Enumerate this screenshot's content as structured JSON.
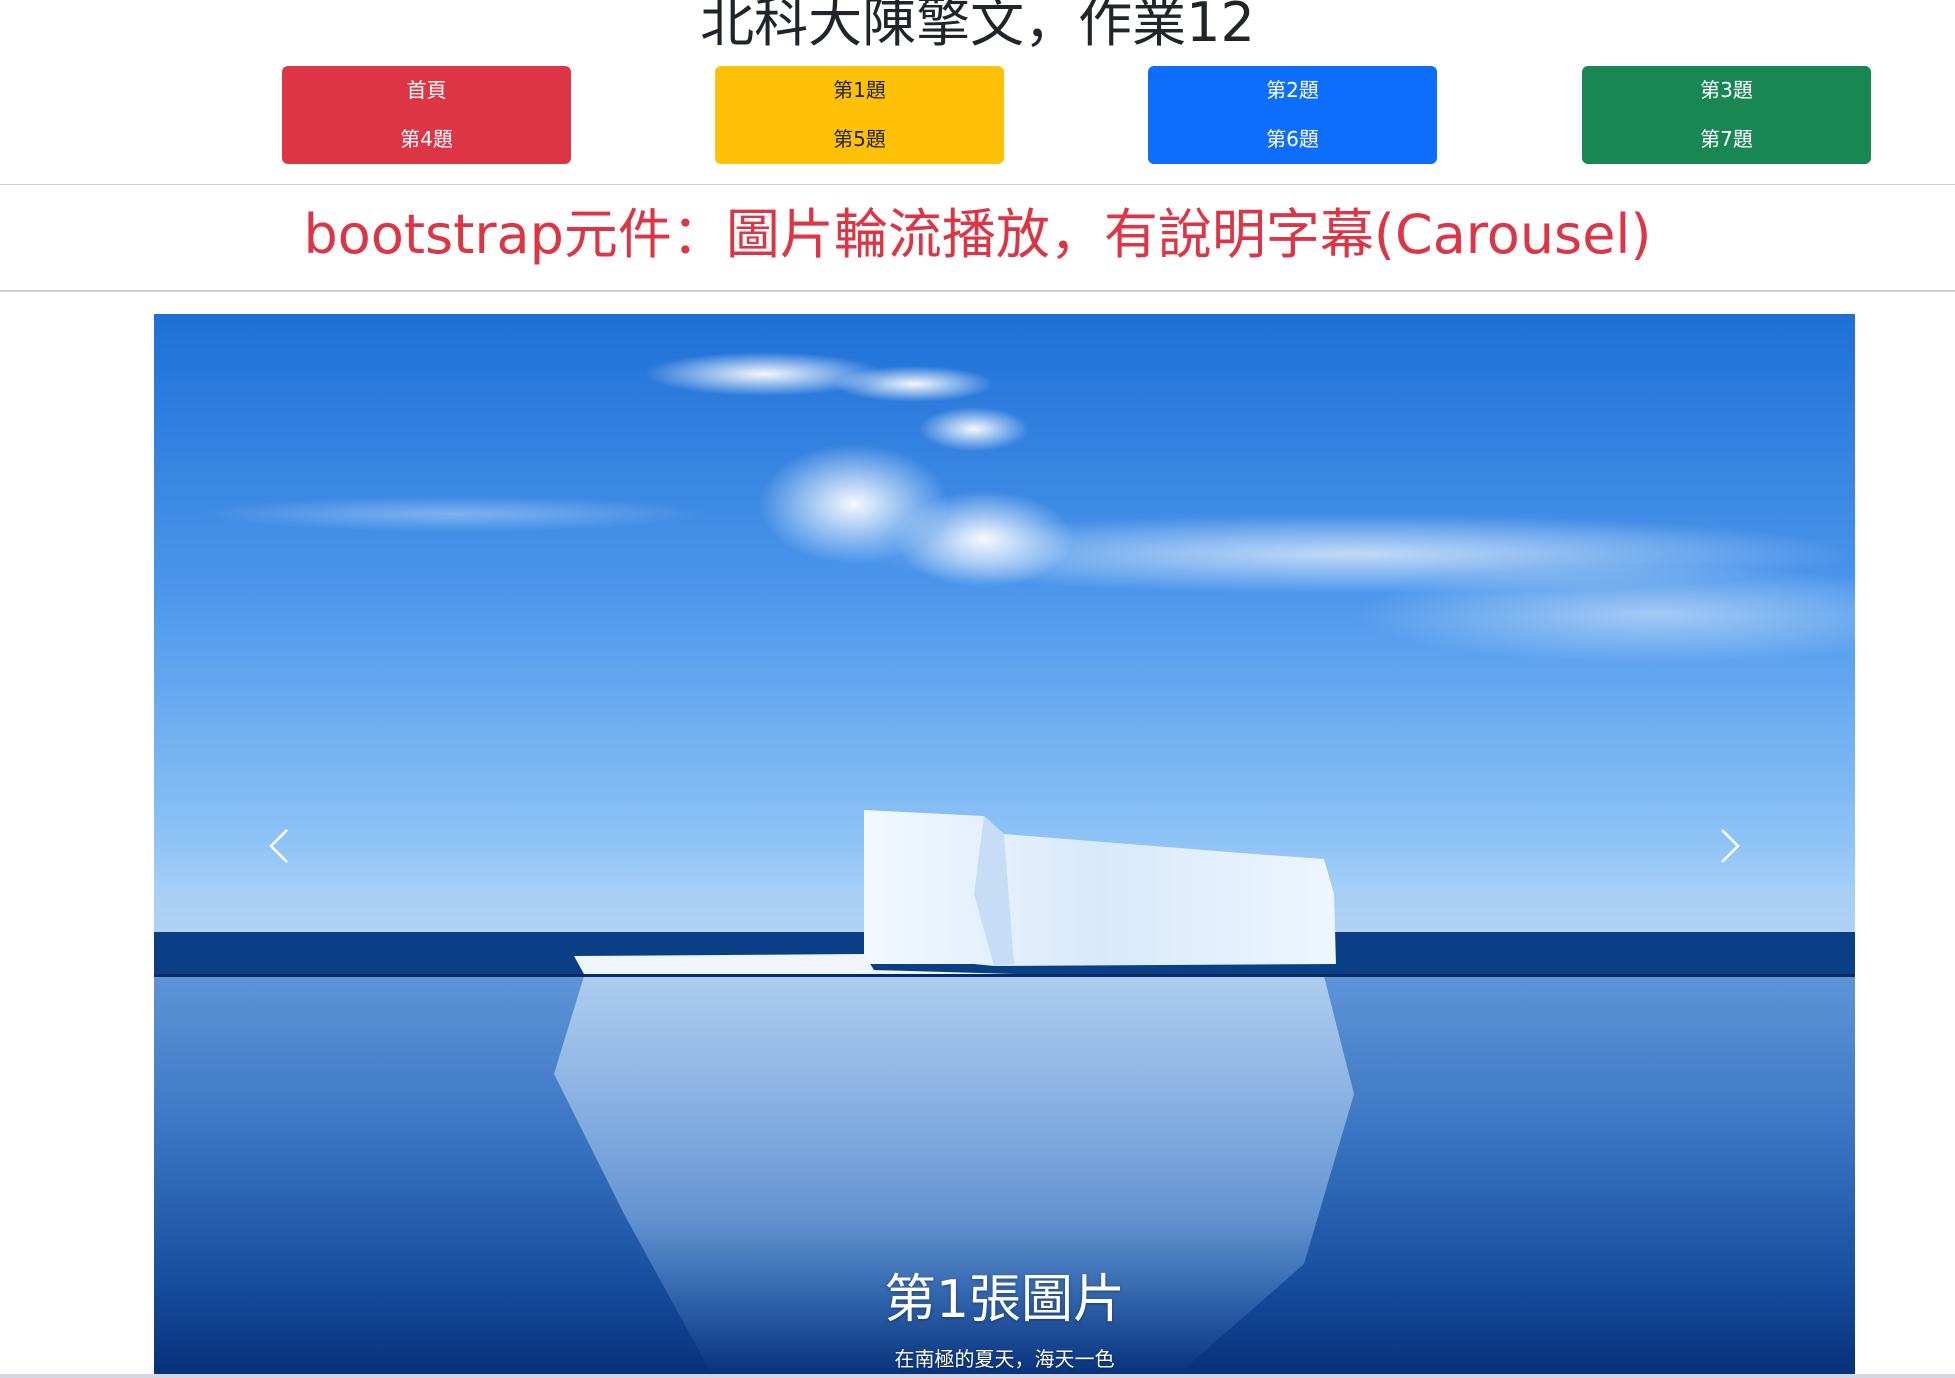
{
  "header": {
    "site_title": "北科大陳擎文，作業12"
  },
  "nav": {
    "row1": [
      {
        "label": "首頁",
        "color": "#dc3545"
      },
      {
        "label": "第1題",
        "color": "#ffc107"
      },
      {
        "label": "第2題",
        "color": "#0d6efd"
      },
      {
        "label": "第3題",
        "color": "#198754"
      }
    ],
    "row2": [
      {
        "label": "第4題",
        "color": "#dc3545"
      },
      {
        "label": "第5題",
        "color": "#ffc107"
      },
      {
        "label": "第6題",
        "color": "#0d6efd"
      },
      {
        "label": "第7題",
        "color": "#198754"
      }
    ]
  },
  "main": {
    "heading": "bootstrap元件：圖片輪流播放，有說明字幕(Carousel)",
    "heading_color": "#dc3545"
  },
  "carousel": {
    "image_icon": "iceberg-photo",
    "prev_icon": "chevron-left-icon",
    "next_icon": "chevron-right-icon",
    "caption_title": "第1張圖片",
    "caption_text": "在南極的夏天，海天一色"
  }
}
